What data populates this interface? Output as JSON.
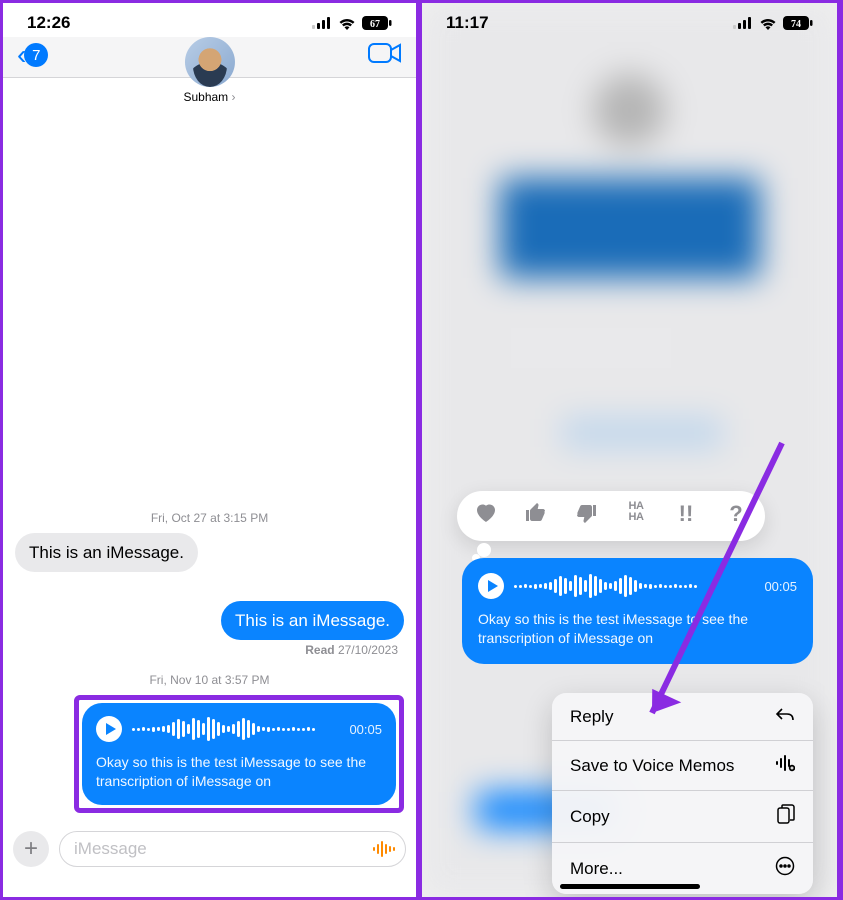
{
  "left": {
    "status": {
      "time": "12:26",
      "battery": "67"
    },
    "nav": {
      "back_badge": "7",
      "contact_name": "Subham"
    },
    "timestamps": {
      "t1": "Fri, Oct 27 at 3:15 PM",
      "t2": "Fri, Nov 10 at 3:57 PM"
    },
    "messages": {
      "incoming_1": "This is an iMessage.",
      "outgoing_1": "This is an iMessage.",
      "receipt_label": "Read",
      "receipt_date": "27/10/2023"
    },
    "audio": {
      "duration": "00:05",
      "transcript": "Okay so this is the test iMessage to see the transcription of iMessage on"
    },
    "input": {
      "placeholder": "iMessage"
    }
  },
  "right": {
    "status": {
      "time": "11:17",
      "battery": "74"
    },
    "audio": {
      "duration": "00:05",
      "transcript": "Okay so this is the test iMessage to see the transcription of iMessage on"
    },
    "reactions": {
      "haha": "HA HA",
      "exclaim": "!!",
      "question": "?"
    },
    "menu": {
      "reply": "Reply",
      "save": "Save to Voice Memos",
      "copy": "Copy",
      "more": "More..."
    }
  }
}
